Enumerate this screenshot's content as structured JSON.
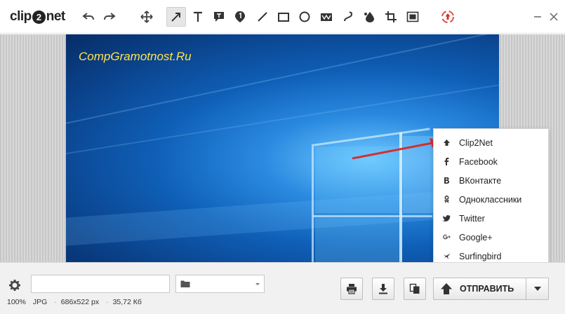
{
  "app": {
    "logo_text_a": "clip",
    "logo_text_b": "2",
    "logo_text_c": "net",
    "accent_color": "#d32f2f"
  },
  "toolbar": {
    "tools": [
      {
        "name": "undo-icon"
      },
      {
        "name": "redo-icon"
      },
      {
        "name": "move-icon"
      },
      {
        "name": "arrow-tool-icon",
        "active": true
      },
      {
        "name": "text-tool-icon"
      },
      {
        "name": "callout-tool-icon"
      },
      {
        "name": "numbered-marker-icon"
      },
      {
        "name": "line-tool-icon"
      },
      {
        "name": "rectangle-tool-icon"
      },
      {
        "name": "ellipse-tool-icon"
      },
      {
        "name": "blur-tool-icon"
      },
      {
        "name": "pencil-tool-icon"
      },
      {
        "name": "fill-tool-icon"
      },
      {
        "name": "crop-tool-icon"
      },
      {
        "name": "resize-tool-icon"
      },
      {
        "name": "upload-circle-icon"
      }
    ]
  },
  "image": {
    "watermark": "CompGramotnost.Ru"
  },
  "menu": {
    "items": [
      {
        "label": "Clip2Net",
        "icon": "clip2net-icon"
      },
      {
        "label": "Facebook",
        "icon": "facebook-icon"
      },
      {
        "label": "ВКонтакте",
        "icon": "vk-icon"
      },
      {
        "label": "Одноклассники",
        "icon": "odnoklassniki-icon"
      },
      {
        "label": "Twitter",
        "icon": "twitter-icon"
      },
      {
        "label": "Google+",
        "icon": "googleplus-icon"
      },
      {
        "label": "Surfingbird",
        "icon": "surfingbird-icon"
      }
    ]
  },
  "bottom": {
    "filename_value": "",
    "folder_value": "",
    "zoom": "100%",
    "format": "JPG",
    "dimensions": "686x522 px",
    "filesize": "35,72 Кб",
    "send_label": "ОТПРАВИТЬ"
  }
}
